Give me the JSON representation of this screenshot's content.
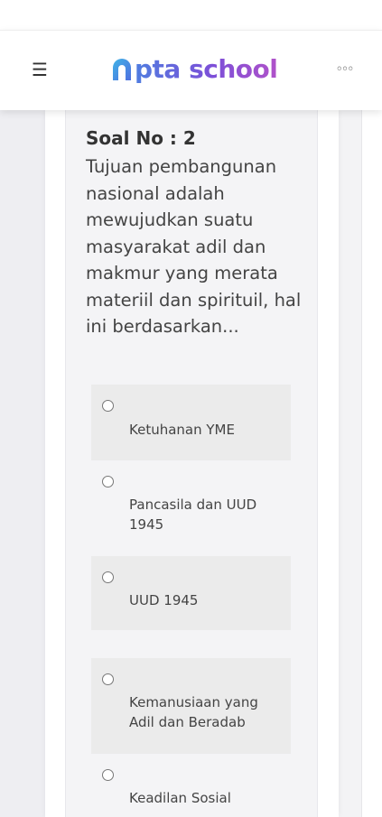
{
  "header": {
    "logo_text": "pta school",
    "menu_icon": "hamburger-icon",
    "more_icon": "more-dots-icon"
  },
  "question": {
    "number_label": "Soal No : 2",
    "text": "Tujuan pembangunan nasional adalah mewujudkan suatu masyarakat adil dan makmur yang merata materiil dan spirituil, hal ini berdasarkan...",
    "options": [
      {
        "label": "Ketuhanan YME",
        "selected": false
      },
      {
        "label": "Pancasila dan UUD 1945",
        "selected": false
      },
      {
        "label": "UUD 1945",
        "selected": false
      },
      {
        "label": "Kemanusiaan yang Adil dan Beradab",
        "selected": false
      },
      {
        "label": "Keadilan Sosial",
        "selected": false
      }
    ]
  },
  "colors": {
    "logo_blue": "#4f7de0",
    "logo_purple": "#7d4fd8",
    "option_bg": "#ebebeb"
  }
}
